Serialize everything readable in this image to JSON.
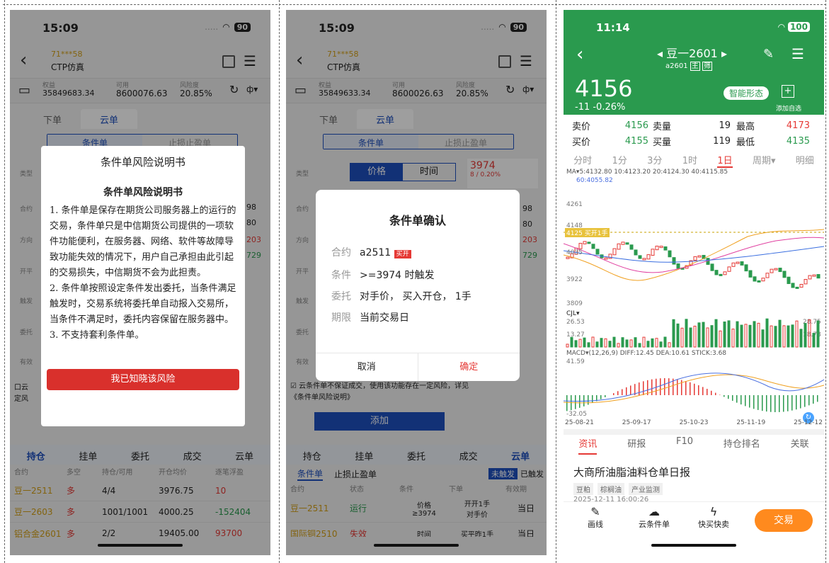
{
  "p1": {
    "time": "15:09",
    "battery": "90",
    "account": "71***58",
    "account_type": "CTP仿真",
    "s_labels": [
      "权益",
      "可用",
      "风险度"
    ],
    "s_values": [
      "35849683.34",
      "8600076.63",
      "20.85%"
    ],
    "tab_order": "下单",
    "tab_cloud": "云单",
    "sub_tabs": [
      "条件单",
      "止损止盈单"
    ],
    "side_labels": [
      "类型",
      "合约",
      "方向",
      "开平",
      "触发",
      "委托",
      "有效"
    ],
    "right_vals": [
      "98",
      "80",
      "203",
      "729"
    ],
    "modal_title": "条件单风险说明书",
    "modal_heading": "条件单风险说明书",
    "modal_body": [
      "1. 条件单是保存在期货公司服务器上的运行的交易，条件单只是中信期货公司提供的一项软件功能便利，在服务器、网络、软件等故障导致功能失效的情况下，用户自己承担由此引起的交易损失，中信期货不会为此担责。",
      "2. 条件单按照设定条件发出委托，当条件满足触发时，交易系统将委托单自动报入交易所，当条件不满足时，委托内容保留在服务器中。",
      "3. 不支持套利条件单。"
    ],
    "modal_btn": "我已知晓该风险",
    "cb_text": "口云",
    "cb_text2": "定风",
    "bottom_tabs": [
      "持仓",
      "挂单",
      "委托",
      "成交",
      "云单"
    ],
    "table_head": [
      "合约",
      "多空",
      "持仓/可用",
      "开仓均价",
      "逐笔浮盈"
    ],
    "rows": [
      [
        "豆一2511",
        "多",
        "4/4",
        "3976.75",
        "10"
      ],
      [
        "豆一2603",
        "多",
        "1001/1001",
        "4000.25",
        "-152404"
      ],
      [
        "铝合金2601",
        "多",
        "2/2",
        "19405.00",
        "93700"
      ]
    ]
  },
  "p2": {
    "time": "15:09",
    "battery": "90",
    "account": "71***58",
    "account_type": "CTP仿真",
    "s_labels": [
      "权益",
      "可用",
      "风险度"
    ],
    "s_values": [
      "35849633.34",
      "8600026.63",
      "20.85%"
    ],
    "tab_order": "下单",
    "tab_cloud": "云单",
    "sub_tabs": [
      "条件单",
      "止损止盈单"
    ],
    "type_label": "类型",
    "type_opts": [
      "价格",
      "时间"
    ],
    "price": "3974",
    "price_sub": "8 / 0.20%",
    "side_labels": [
      "合约",
      "方向",
      "开平",
      "触发",
      "委托",
      "有效"
    ],
    "right_vals": [
      "98",
      "80",
      "203",
      "729"
    ],
    "dlg_title": "条件单确认",
    "dlg_rows": [
      [
        "合约",
        "a2511"
      ],
      [
        "条件",
        ">=3974 时触发"
      ],
      [
        "委托",
        "对手价， 买入开仓， 1手"
      ],
      [
        "期限",
        "当前交易日"
      ]
    ],
    "badge": "买开",
    "dlg_cancel": "取消",
    "dlg_ok": "确定",
    "note": "☑ 云条件单不保证成交，使用该功能存在一定风险，详见《条件单风险说明》",
    "add": "添加",
    "bottom_tabs": [
      "持仓",
      "挂单",
      "委托",
      "成交",
      "云单"
    ],
    "sub2": [
      "条件单",
      "止损止盈单"
    ],
    "filters": [
      "未触发",
      "已触发"
    ],
    "table_head": [
      "合约",
      "状态",
      "条件",
      "下单",
      "有效期"
    ],
    "rows": [
      [
        "豆一2511",
        "运行",
        "价格\n≥3974",
        "开开1手\n对手价",
        "当日"
      ],
      [
        "国际铜2510",
        "失效",
        "时间",
        "买平昨1手",
        "当日"
      ]
    ]
  },
  "p3": {
    "time": "11:14",
    "battery": "100",
    "title": "豆一2601",
    "code": "a2601",
    "tags": [
      "主",
      "筛"
    ],
    "price": "4156",
    "chg": "-11 -0.26%",
    "smart": "智能形态",
    "fav": "添加自选",
    "quote": [
      [
        "卖价",
        "4156",
        "卖量",
        "19",
        "最高",
        "4173"
      ],
      [
        "买价",
        "4155",
        "买量",
        "119",
        "最低",
        "4135"
      ]
    ],
    "periods": [
      "分时",
      "1分",
      "3分",
      "1时",
      "1日",
      "周期▾",
      "明细"
    ],
    "ma": "MA▾5:4132.80 10:4123.20 20:4124.30 40:4115.85",
    "ma2": "60:4055.82",
    "y_labels": [
      "4261",
      "4148",
      "4035",
      "3922",
      "3809"
    ],
    "order_tag": "4125 买开1手",
    "cjl": "CJL▾",
    "cjl_y": [
      "26.53",
      "13.27"
    ],
    "cjl_r": [
      "28.75",
      "18.78"
    ],
    "macd": "MACD▾(12,26,9) DIFF:12.45 DEA:10.61 STICK:3.68",
    "macd_y": [
      "41.59",
      "-32.05"
    ],
    "dates": [
      "25-08-21",
      "25-09-17",
      "25-10-23",
      "25-11-19",
      "25-12-12"
    ],
    "news_tabs": [
      "资讯",
      "研报",
      "F10",
      "持仓排名",
      "关联"
    ],
    "news_title": "大商所油脂油料仓单日报",
    "news_tags": [
      "豆粕",
      "棕榈油",
      "产业监测"
    ],
    "news_time": "2025-12-11 16:00:26",
    "actions": [
      "画线",
      "云条件单",
      "快买快卖"
    ],
    "trade": "交易",
    "colors": {
      "green": "#2a9a4e",
      "red": "#e53935",
      "blue": "#1e4fbf"
    }
  }
}
